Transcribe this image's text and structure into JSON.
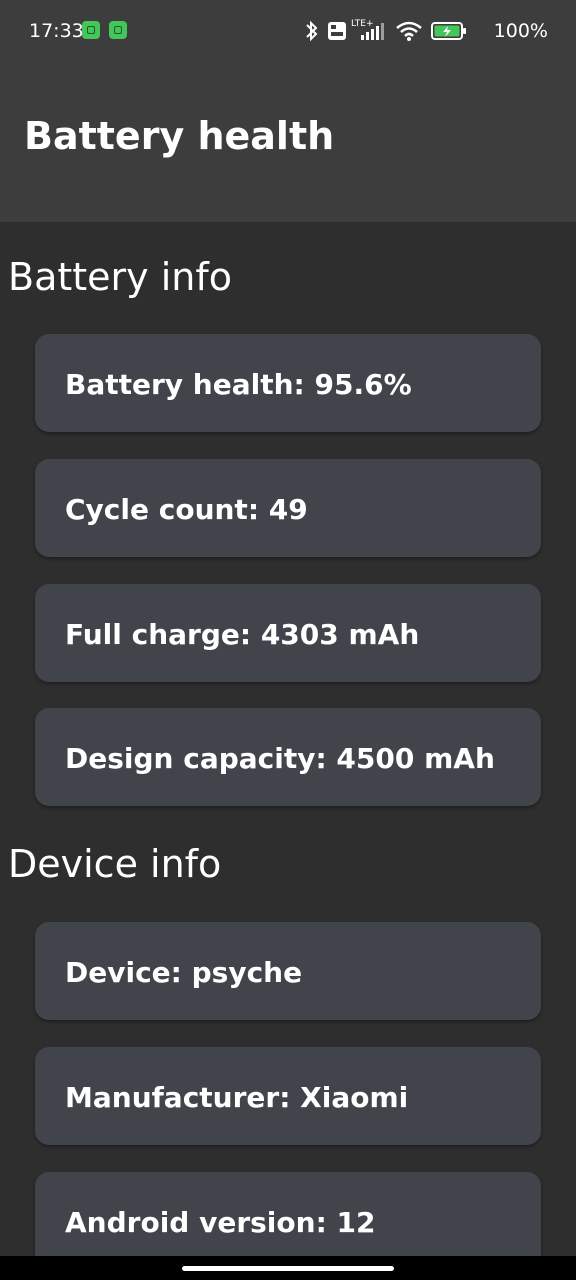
{
  "status_bar": {
    "time": "17:33",
    "icons": [
      "notification-app-icon",
      "notification-app-icon",
      "bluetooth-icon",
      "volte-icon",
      "lte-signal-icon",
      "wifi-icon",
      "battery-charging-icon"
    ],
    "volte_label": "Vo\nLTE",
    "network_label": "LTE+",
    "battery_percent": "100%"
  },
  "app_bar": {
    "title": "Battery health"
  },
  "sections": [
    {
      "title": "Battery info",
      "items": [
        "Battery health: 95.6%",
        "Cycle count: 49",
        "Full charge: 4303 mAh",
        "Design capacity: 4500 mAh"
      ]
    },
    {
      "title": "Device info",
      "items": [
        "Device: psyche",
        "Manufacturer: Xiaomi",
        "Android version: 12"
      ]
    }
  ],
  "colors": {
    "background": "#2e2e2e",
    "app_bar": "#3d3d3d",
    "card": "#41454b",
    "battery_accent": "#44c75a",
    "text": "#ffffff"
  }
}
